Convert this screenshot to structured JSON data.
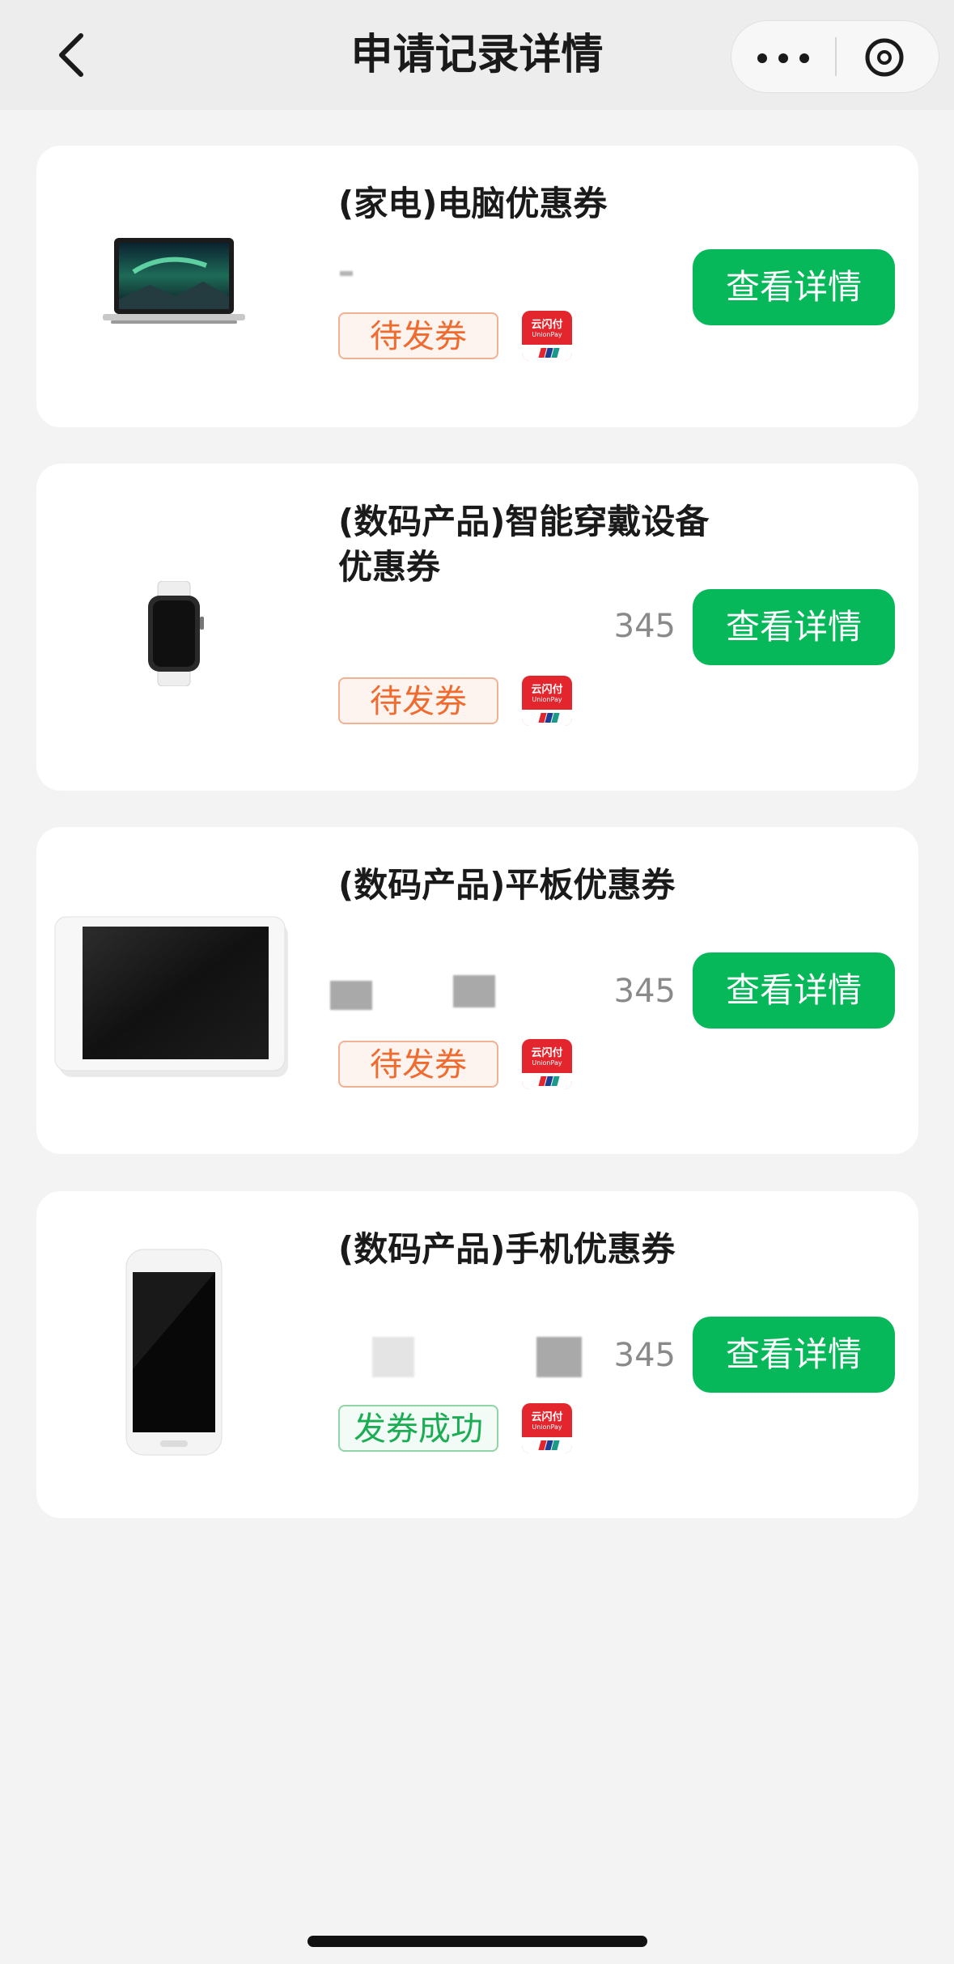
{
  "nav": {
    "title": "申请记录详情"
  },
  "items": [
    {
      "title": "(家电)电脑优惠券",
      "number": "",
      "status": "待发券",
      "button": "查看详情"
    },
    {
      "title": "(数码产品)智能穿戴设备优惠券",
      "number": "345",
      "status": "待发券",
      "button": "查看详情"
    },
    {
      "title": "(数码产品)平板优惠券",
      "number": "345",
      "status": "待发券",
      "button": "查看详情"
    },
    {
      "title": "(数码产品)手机优惠券",
      "number": "345",
      "status": "发券成功",
      "button": "查看详情"
    }
  ],
  "unionpay": {
    "brand": "云闪付",
    "sub": "UnionPay"
  },
  "colors": {
    "accent_green": "#07b85a",
    "pending_orange": "#ef6b2f",
    "success_green": "#1aad53",
    "unionpay_red": "#e3262d"
  },
  "icons": [
    "back-chevron-icon",
    "more-dots-icon",
    "close-circle-icon",
    "unionpay-logo-icon"
  ]
}
